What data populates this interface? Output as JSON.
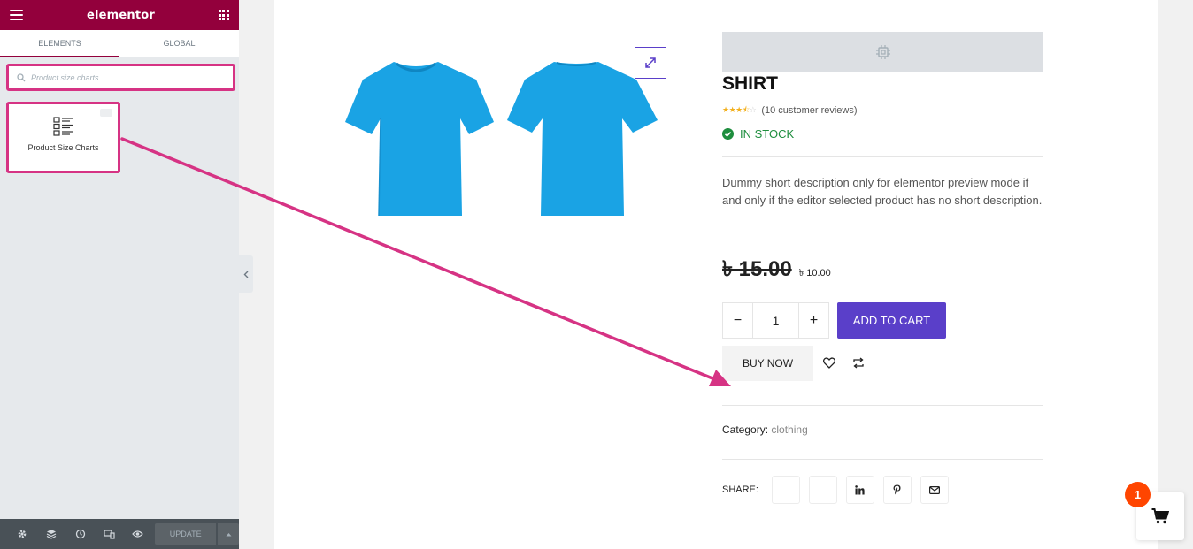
{
  "colors": {
    "brand": "#93003c",
    "highlight": "#d63384",
    "accent": "#5a3fc9",
    "in_stock": "#1e8e3e",
    "cart_badge": "#ff4500",
    "shirt": "#1aa3e4"
  },
  "editor": {
    "brand": "elementor",
    "tabs": [
      {
        "label": "ELEMENTS"
      },
      {
        "label": "GLOBAL"
      }
    ],
    "search": {
      "placeholder": "Product size charts"
    },
    "widget": {
      "label": "Product Size Charts"
    },
    "footer": {
      "icons": [
        "settings-icon",
        "navigator-icon",
        "history-icon",
        "responsive-icon",
        "preview-eye-icon"
      ],
      "update_label": "UPDATE"
    }
  },
  "product": {
    "title": "SHIRT",
    "rating": {
      "value": 3.5,
      "max": 5,
      "reviews_label": "(10 customer reviews)"
    },
    "stock": "IN STOCK",
    "description": "Dummy short description only for elementor preview mode if and only if the editor selected product has no short description.",
    "old_price": "৳ 15.00",
    "new_price": "৳ 10.00",
    "quantity": "1",
    "add_to_cart": "ADD TO CART",
    "buy_now": "BUY NOW",
    "category_label": "Category:",
    "category_value": "clothing",
    "share_label": "SHARE:",
    "share_icons": [
      "facebook-icon",
      "twitter-icon",
      "linkedin-icon",
      "pinterest-icon",
      "email-icon"
    ]
  },
  "mini_cart": {
    "count": "1"
  }
}
